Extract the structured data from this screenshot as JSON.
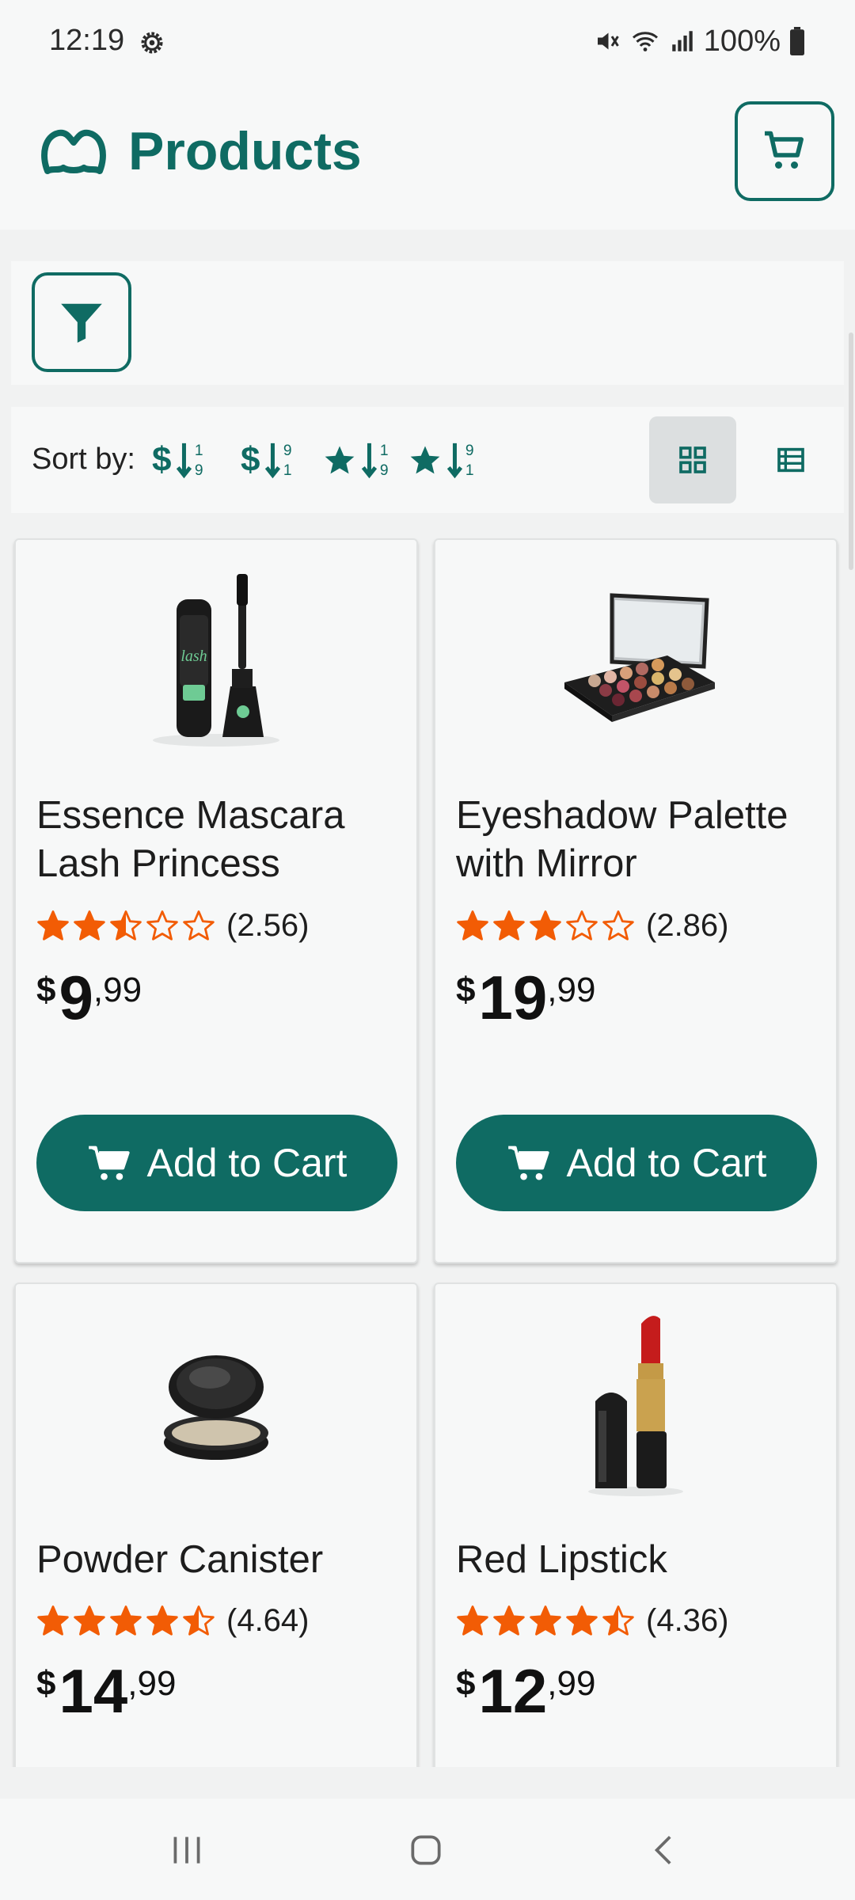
{
  "status_bar": {
    "time": "12:19",
    "battery": "100%"
  },
  "app_bar": {
    "title": "Products"
  },
  "sort": {
    "label": "Sort by:"
  },
  "colors": {
    "primary": "#0f6b63",
    "star": "#f25c05",
    "background": "#f7f8f8"
  },
  "products": [
    {
      "name": "Essence Mascara Lash Princess",
      "rating": 2.56,
      "rating_text": "(2.56)",
      "currency": "$",
      "price_int": "9",
      "price_dec": ",99",
      "button": "Add to Cart"
    },
    {
      "name": "Eyeshadow Palette with Mirror",
      "rating": 2.86,
      "rating_text": "(2.86)",
      "currency": "$",
      "price_int": "19",
      "price_dec": ",99",
      "button": "Add to Cart"
    },
    {
      "name": "Powder Canister",
      "rating": 4.64,
      "rating_text": "(4.64)",
      "currency": "$",
      "price_int": "14",
      "price_dec": ",99"
    },
    {
      "name": "Red Lipstick",
      "rating": 4.36,
      "rating_text": "(4.36)",
      "currency": "$",
      "price_int": "12",
      "price_dec": ",99"
    }
  ]
}
